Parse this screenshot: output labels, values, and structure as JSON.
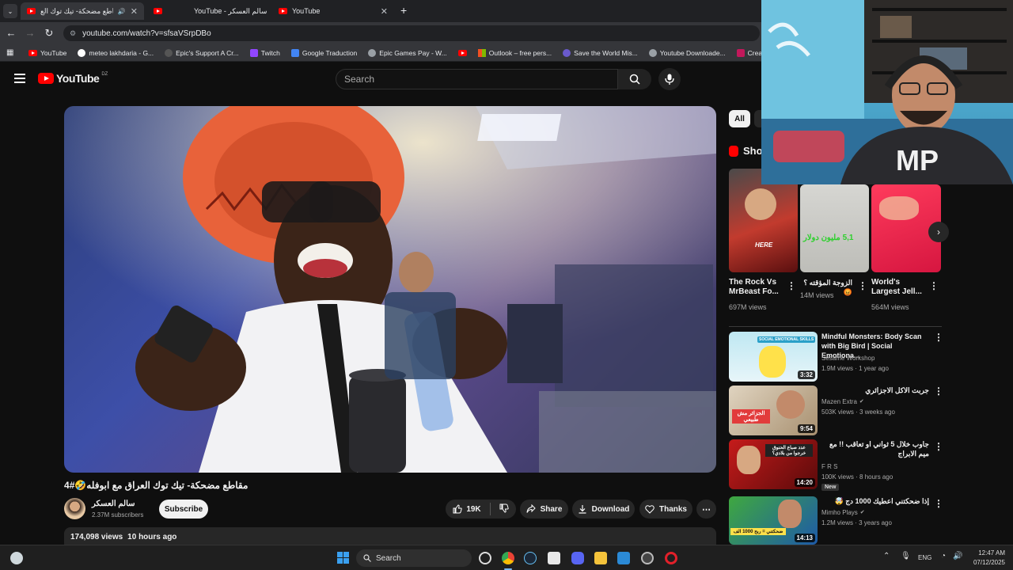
{
  "browser": {
    "tabs": [
      {
        "title": "مقاطع مضحكة- تيك توك الع",
        "active": true
      },
      {
        "title": "YouTube - سالم العسكر",
        "active": false
      },
      {
        "title": "YouTube",
        "active": false
      }
    ],
    "url": "youtube.com/watch?v=sfsaVSrpDBo",
    "bookmarks": [
      "YouTube",
      "meteo lakhdaria - G...",
      "Epic's Support A Cr...",
      "Twitch",
      "Google Traduction",
      "Epic Games Pay - W...",
      "",
      "Outlook – free pers...",
      "Save the World Mis...",
      "Youtube Downloade...",
      "Create a Store, Scal..."
    ]
  },
  "youtube": {
    "logo": "YouTube",
    "region": "DZ",
    "search_placeholder": "Search"
  },
  "video": {
    "title": "مقاطع مضحكة- تيك توك العراق مع ابوفله🤣#4",
    "channel": "سالم العسكر",
    "subscribers": "2.37M subscribers",
    "subscribe_label": "Subscribe",
    "likes": "19K",
    "share_label": "Share",
    "download_label": "Download",
    "thanks_label": "Thanks",
    "views": "174,098 views",
    "age": "10 hours ago"
  },
  "sidebar": {
    "chip_all": "All",
    "shorts_heading": "Sho",
    "shorts": [
      {
        "title": "The Rock Vs MrBeast Fo...",
        "views": "697M views",
        "overlay": "HERE"
      },
      {
        "title": "الزوجة المؤقته ؟ 😡",
        "views": "14M views",
        "overlay": "5,1 مليون دولار"
      },
      {
        "title": "World's Largest Jell...",
        "views": "564M views",
        "overlay": ""
      }
    ],
    "recommendations": [
      {
        "title": "Mindful Monsters: Body Scan with Big Bird | Social Emotiona...",
        "channel": "Sesame Workshop",
        "meta": "1.9M views · 1 year ago",
        "duration": "3:32",
        "verified": false,
        "badge": "",
        "thumb_text": "SOCIAL EMOTIONAL SKILLS"
      },
      {
        "title": "جربت الاكل الاجزائري",
        "channel": "Mazen Extra",
        "meta": "503K views · 3 weeks ago",
        "duration": "9:54",
        "verified": true,
        "badge": "",
        "thumb_text": "الجزائر مش طبيعي"
      },
      {
        "title": "جاوب خلال 5 ثواني او تعاقب !! مع ميم الابراج",
        "channel": "F R S",
        "meta": "100K views · 8 hours ago",
        "duration": "14:20",
        "verified": false,
        "badge": "New",
        "thumb_text": "عدد صباع الحنوق خرجوا من بلادي؟"
      },
      {
        "title": "إذا ضحكتني اعطيك 1000 دج 🤯",
        "channel": "Mimho Plays",
        "meta": "1.2M views · 3 years ago",
        "duration": "14:13",
        "verified": true,
        "badge": "",
        "thumb_text": "ضحكتني = ربح 1000 الف"
      }
    ]
  },
  "taskbar": {
    "search_label": "Search",
    "language": "ENG",
    "time": "12:47 AM",
    "date": "07/12/2025"
  },
  "colors": {
    "youtube_red": "#ff0000",
    "background": "#0f0f0f",
    "pill": "#272727"
  }
}
